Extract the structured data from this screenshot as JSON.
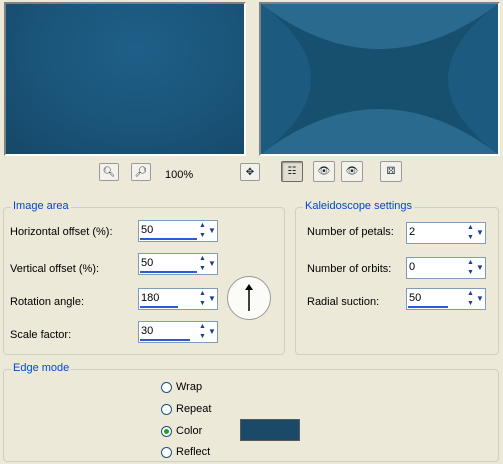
{
  "colors": {
    "preview_bg": "#17506f",
    "edge_color_swatch": "#1b4a68",
    "legend_text": "#0046d5"
  },
  "toolbar": {
    "zoom_out_icon": "magnifier-minus-icon",
    "zoom_in_icon": "magnifier-plus-icon",
    "zoom_level": "100%",
    "move_icon": "four-arrows-move-icon",
    "proof_icon": "proof-preview-icon",
    "reset_icon": "reset-eye-icon",
    "preview_icon": "eye-preview-icon",
    "randomize_icon": "dice-icon"
  },
  "image_area": {
    "title": "Image area",
    "horizontal_offset": {
      "label": "Horizontal offset (%):",
      "value": "50",
      "fill": 0.5
    },
    "vertical_offset": {
      "label": "Vertical offset (%):",
      "value": "50",
      "fill": 0.5
    },
    "rotation_angle": {
      "label": "Rotation angle:",
      "value": "180",
      "fill": 0.5,
      "dial_icon": "rotation-dial-icon"
    },
    "scale_factor": {
      "label": "Scale factor:",
      "value": "30",
      "fill": 0.65
    }
  },
  "kaleidoscope": {
    "title": "Kaleidoscope settings",
    "number_of_petals": {
      "label": "Number of petals:",
      "value": "2",
      "fill": 0.0
    },
    "number_of_orbits": {
      "label": "Number of orbits:",
      "value": "0",
      "fill": 0.0
    },
    "radial_suction": {
      "label": "Radial suction:",
      "value": "50",
      "fill": 0.5
    }
  },
  "edge_mode": {
    "title": "Edge mode",
    "options": [
      {
        "label": "Wrap",
        "checked": false
      },
      {
        "label": "Repeat",
        "checked": false
      },
      {
        "label": "Color",
        "checked": true
      },
      {
        "label": "Reflect",
        "checked": false
      }
    ]
  }
}
